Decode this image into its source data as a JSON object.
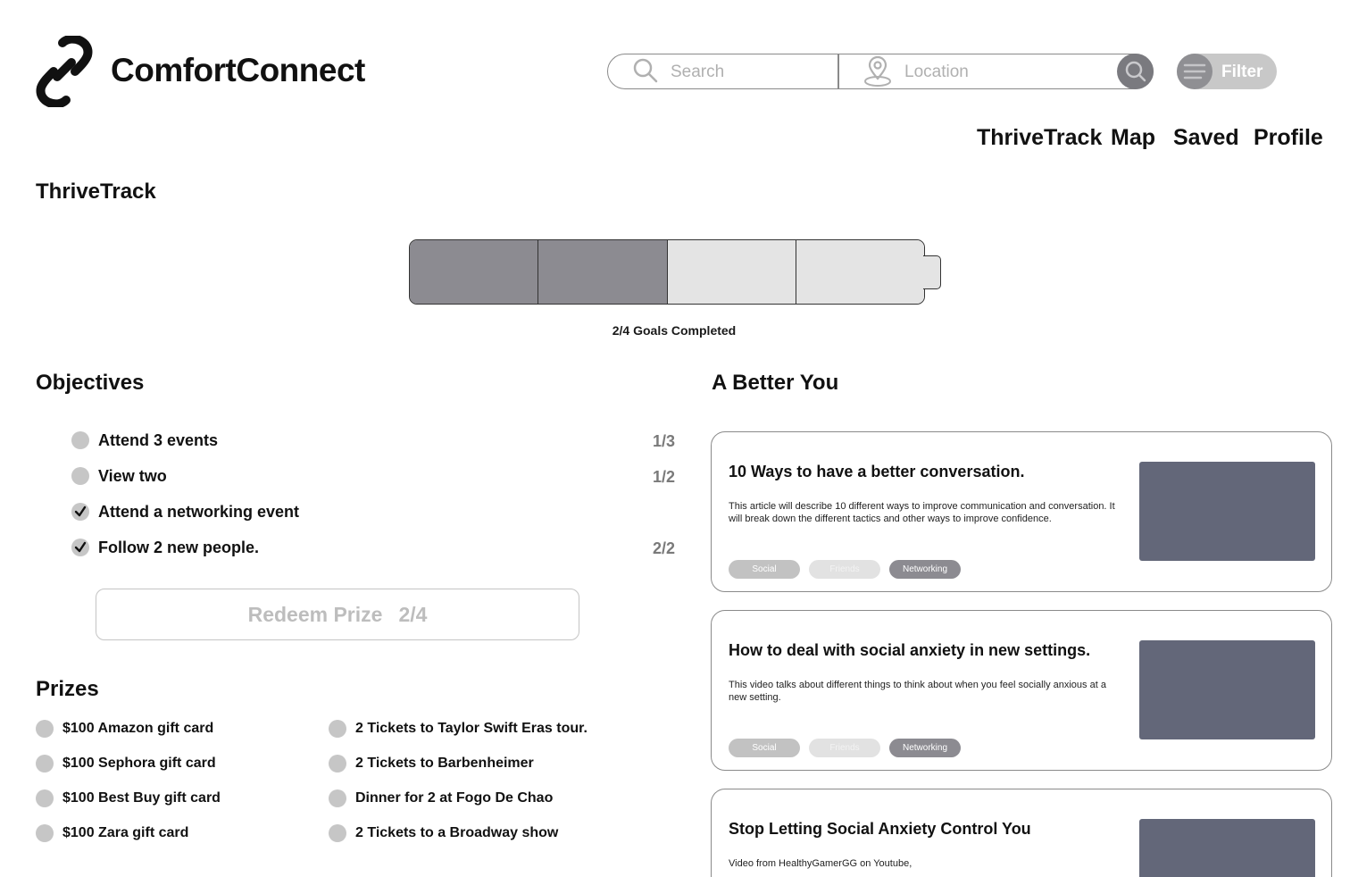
{
  "app": {
    "brand": "ComfortConnect"
  },
  "search": {
    "placeholder": "Search",
    "location_placeholder": "Location"
  },
  "filter": {
    "label": "Filter"
  },
  "nav": {
    "items": [
      "ThriveTrack",
      "Map",
      "Saved",
      "Profile"
    ]
  },
  "page": {
    "title": "ThriveTrack"
  },
  "progress": {
    "label": "2/4 Goals Completed",
    "completed": 2,
    "total": 4
  },
  "objectives": {
    "title": "Objectives",
    "items": [
      {
        "label": "Attend 3 events",
        "count": "1/3",
        "done": false
      },
      {
        "label": "View two",
        "count": "1/2",
        "done": false
      },
      {
        "label": "Attend a networking event",
        "count": "",
        "done": true
      },
      {
        "label": "Follow 2 new people.",
        "count": "2/2",
        "done": true
      }
    ],
    "redeem_label": "Redeem Prize",
    "redeem_count": "2/4"
  },
  "prizes": {
    "title": "Prizes",
    "items": [
      "$100 Amazon gift card",
      "$100 Sephora gift card",
      "$100 Best Buy gift card",
      "$100 Zara gift card",
      "2 Tickets to Taylor Swift Eras tour.",
      "2 Tickets to Barbenheimer",
      "Dinner for 2 at Fogo De Chao",
      "2 Tickets to a Broadway show"
    ]
  },
  "better_you": {
    "title": "A Better You",
    "cards": [
      {
        "title": "10 Ways to have a better conversation.",
        "description": "This article will describe 10 different ways to improve communication and conversation. It will break down the different tactics and other ways to improve confidence.",
        "tags": [
          "Social",
          "Friends",
          "Networking"
        ]
      },
      {
        "title": "How to deal with social anxiety in new settings.",
        "description": "This video talks about different things to think about when you feel socially anxious at a new setting.",
        "tags": [
          "Social",
          "Friends",
          "Networking"
        ]
      },
      {
        "title": "Stop Letting Social Anxiety Control You",
        "description": "Video from HealthyGamerGG on Youtube,",
        "tags": []
      }
    ]
  },
  "colors": {
    "filled_segment": "#8c8b91",
    "empty_segment": "#e4e4e4",
    "thumbnail": "#636779",
    "muted_text": "#b0b0b0"
  }
}
